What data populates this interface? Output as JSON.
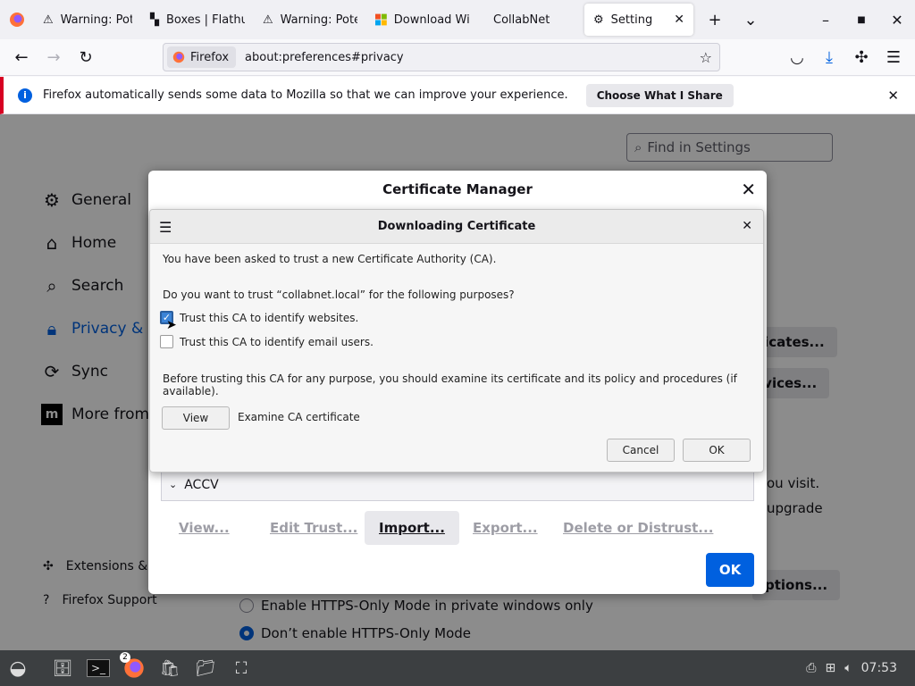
{
  "colors": {
    "accent": "#0060df",
    "warning_border": "#d70022"
  },
  "tabs": [
    {
      "label": "Warning: Pote",
      "icon": "warning-icon"
    },
    {
      "label": "Boxes | Flathu",
      "icon": "flathub-icon"
    },
    {
      "label": "Warning: Pote",
      "icon": "warning-icon"
    },
    {
      "label": "Download Win",
      "icon": "windows-logo-icon"
    },
    {
      "label": "CollabNet",
      "icon": ""
    },
    {
      "label": "Settings",
      "icon": "gear-icon",
      "active": true
    }
  ],
  "urlbar": {
    "identity": "Firefox",
    "url": "about:preferences#privacy"
  },
  "notification": {
    "message": "Firefox automatically sends some data to Mozilla so that we can improve your experience.",
    "button": "Choose What I Share"
  },
  "settings": {
    "search_placeholder": "Find in Settings",
    "categories": [
      "General",
      "Home",
      "Search",
      "Privacy & Se",
      "Sync",
      "More from M"
    ],
    "side_links": [
      "Extensions & T",
      "Firefox Support"
    ],
    "right_buttons": [
      "ificates...",
      "evices...",
      "ptions..."
    ],
    "right_text": [
      "ou visit.",
      "upgrade"
    ],
    "https_options": [
      "Enable HTTPS-Only Mode in private windows only",
      "Don’t enable HTTPS-Only Mode"
    ]
  },
  "cert_manager": {
    "title": "Certificate Manager",
    "tree_row": "ACCV",
    "buttons": [
      "View...",
      "Edit Trust...",
      "Import...",
      "Export...",
      "Delete or Distrust..."
    ],
    "ok": "OK"
  },
  "download_dialog": {
    "title": "Downloading Certificate",
    "intro": "You have been asked to trust a new Certificate Authority (CA).",
    "question": "Do you want to trust “collabnet.local” for the following purposes?",
    "option_websites": "Trust this CA to identify websites.",
    "option_websites_checked": true,
    "option_email": "Trust this CA to identify email users.",
    "option_email_checked": false,
    "advice": "Before trusting this CA for any purpose, you should examine its certificate and its policy and procedures (if available).",
    "view_button": "View",
    "examine_label": "Examine CA certificate",
    "cancel": "Cancel",
    "ok": "OK"
  },
  "taskbar": {
    "badge": "2",
    "clock": "07:53"
  }
}
